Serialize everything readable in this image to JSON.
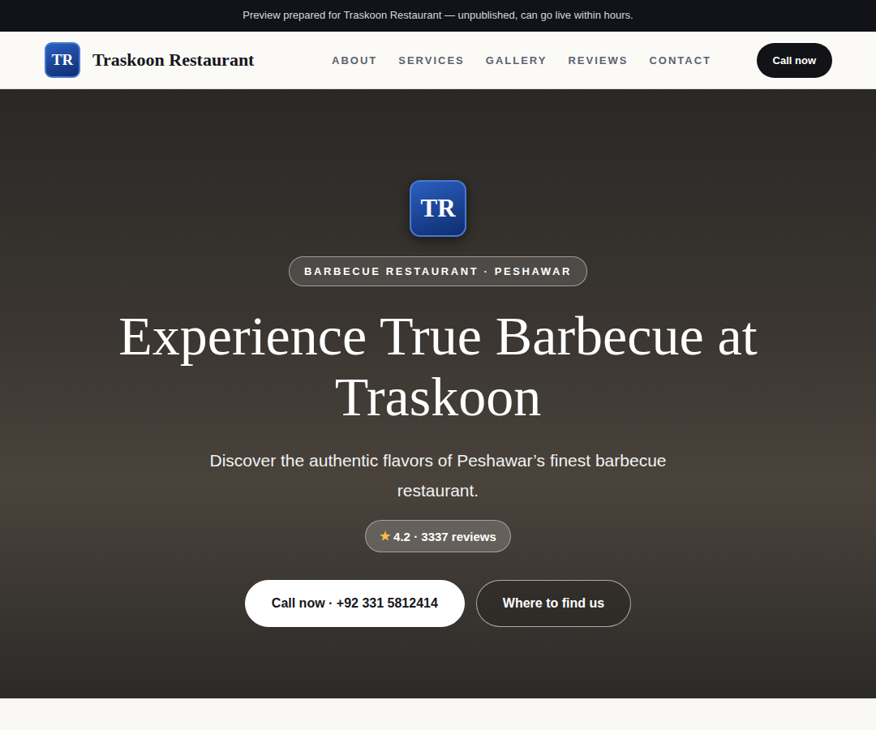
{
  "banner": "Preview prepared for Traskoon Restaurant — unpublished, can go live within hours.",
  "nav": {
    "logo": "TR",
    "name": "Traskoon Restaurant",
    "links": [
      "ABOUT",
      "SERVICES",
      "GALLERY",
      "REVIEWS",
      "CONTACT"
    ],
    "cta": "Call now"
  },
  "hero": {
    "logo": "TR",
    "tag": "BARBECUE RESTAURANT · PESHAWAR",
    "title": "Experience True Barbecue at Traskoon",
    "subtitle": "Discover the authentic flavors of Peshawar’s finest barbecue restaurant.",
    "rating": {
      "star": "★",
      "text": "4.2 · 3337 reviews"
    },
    "buttons": [
      {
        "label": "Call now · +92 331 5812414",
        "kind": "primary"
      },
      {
        "label": "Where to find us",
        "kind": "outline"
      }
    ]
  }
}
